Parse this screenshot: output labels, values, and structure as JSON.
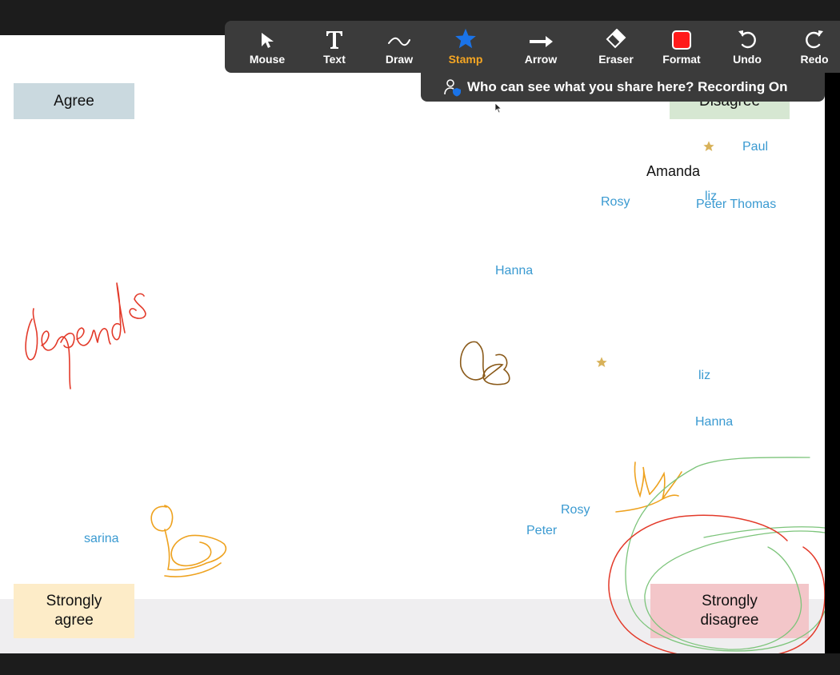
{
  "toolbar": {
    "tools": [
      {
        "label": "Mouse",
        "icon": "cursor-arrow-icon"
      },
      {
        "label": "Text",
        "icon": "text-T-icon"
      },
      {
        "label": "Draw",
        "icon": "squiggle-icon"
      },
      {
        "label": "Stamp",
        "icon": "star-icon",
        "active": true
      },
      {
        "label": "Arrow",
        "icon": "right-arrow-icon"
      },
      {
        "label": "Eraser",
        "icon": "eraser-icon"
      },
      {
        "label": "Format",
        "icon": "color-swatch-icon",
        "color": "#ff1a1a"
      },
      {
        "label": "Undo",
        "icon": "undo-icon"
      },
      {
        "label": "Redo",
        "icon": "redo-icon"
      }
    ]
  },
  "share_banner": {
    "text": "Who can see what you share here? Recording On"
  },
  "board": {
    "corners": {
      "agree": {
        "label": "Agree",
        "color": "#cad9df"
      },
      "disagree": {
        "label": "Disagree",
        "color": "#d6e7d2"
      },
      "strongly_agree": {
        "label": "Strongly agree",
        "color": "#fdecc8"
      },
      "strongly_disagree": {
        "label": "Strongly disagree",
        "color": "#f3c6c9"
      }
    },
    "names": {
      "paul": "Paul",
      "amanda": "Amanda",
      "liz_top": "liz",
      "rosy_top": "Rosy",
      "peter_thomas": "Peter Thomas",
      "hanna_top": "Hanna",
      "liz_mid": "liz",
      "hanna_mid": "Hanna",
      "rosy_bottom": "Rosy",
      "peter_bottom": "Peter",
      "sarina": "sarina"
    },
    "handwriting": "depends",
    "colors": {
      "label_blue": "#3a9ad1",
      "stamp_gold": "#d8b25a",
      "ink_red": "#e33a2a",
      "ink_orange": "#eea21f",
      "ink_brown": "#8a5a1a",
      "ink_green": "#7cc47a",
      "accent_active": "#f5a623"
    }
  }
}
